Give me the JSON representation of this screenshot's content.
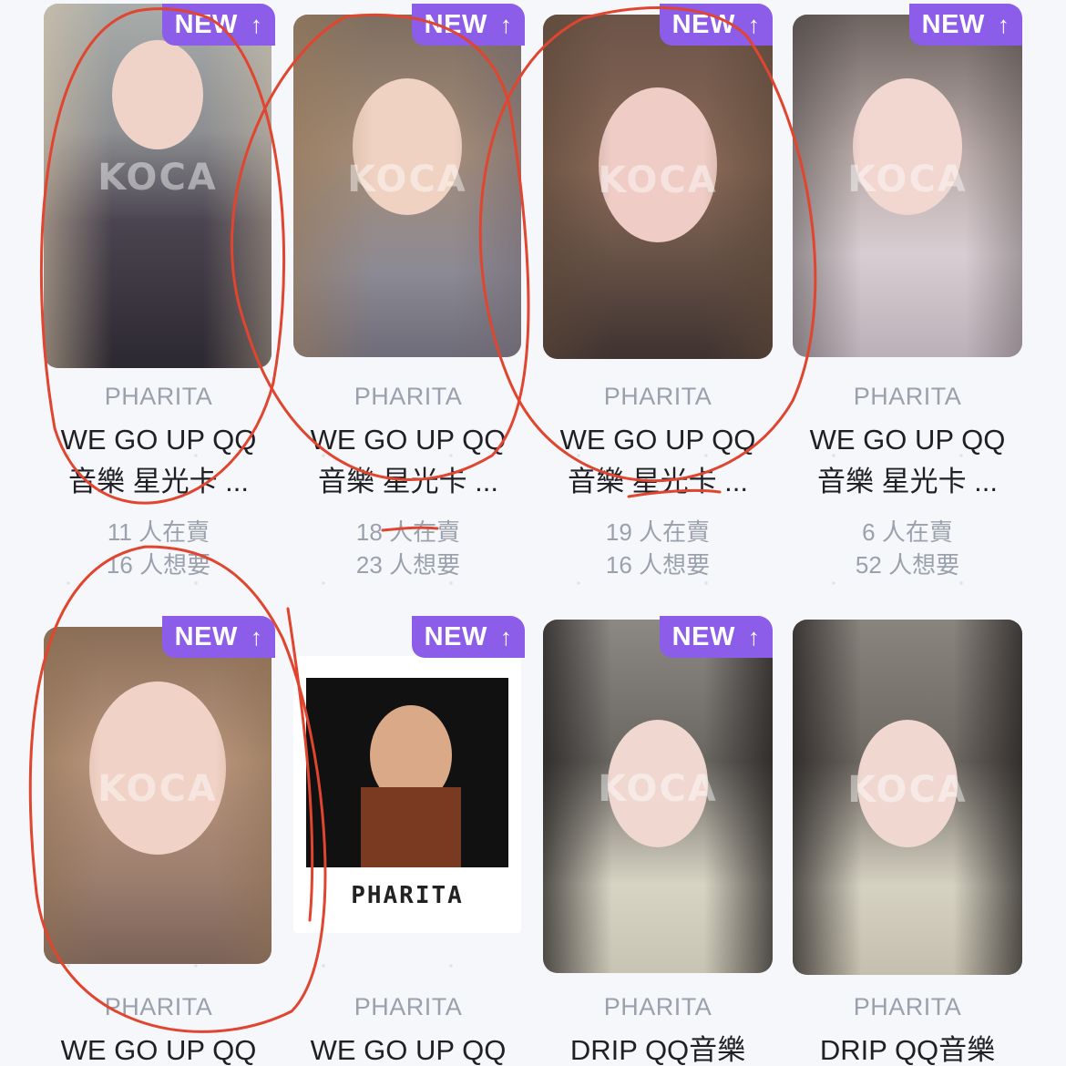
{
  "watermark": "KOCA",
  "colors": {
    "badge": "#8b5de8",
    "artist": "#9aa1ac",
    "title": "#1f1f24",
    "marker": "#e0452f"
  },
  "cards": [
    {
      "badge": "NEW",
      "badge_icon": "arrow-up-icon",
      "artist": "PHARITA",
      "title_line1": "WE GO UP QQ",
      "title_line2": "音樂 星光卡 ...",
      "sellers": "11 人在賣",
      "wanters": "16 人想要"
    },
    {
      "badge": "NEW",
      "badge_icon": "arrow-up-icon",
      "artist": "PHARITA",
      "title_line1": "WE GO UP QQ",
      "title_line2": "音樂 星光卡 ...",
      "sellers": "18 人在賣",
      "wanters": "23 人想要"
    },
    {
      "badge": "NEW",
      "badge_icon": "arrow-up-icon",
      "artist": "PHARITA",
      "title_line1": "WE GO UP QQ",
      "title_line2": "音樂 星光卡 ...",
      "sellers": "19 人在賣",
      "wanters": "16 人想要"
    },
    {
      "badge": "NEW",
      "badge_icon": "arrow-up-icon",
      "artist": "PHARITA",
      "title_line1": "WE GO UP QQ",
      "title_line2": "音樂 星光卡 ...",
      "sellers": "6 人在賣",
      "wanters": "52 人想要"
    },
    {
      "badge": "NEW",
      "badge_icon": "arrow-up-icon",
      "artist": "PHARITA",
      "title_line1": "WE GO UP QQ"
    },
    {
      "badge": "NEW",
      "badge_icon": "arrow-up-icon",
      "artist": "PHARITA",
      "title_line1": "WE GO UP QQ",
      "polaroid_caption": "PHARITA"
    },
    {
      "badge": "NEW",
      "badge_icon": "arrow-up-icon",
      "artist": "PHARITA",
      "title_line1": "DRIP QQ音樂"
    },
    {
      "artist": "PHARITA",
      "title_line1": "DRIP QQ音樂"
    }
  ]
}
